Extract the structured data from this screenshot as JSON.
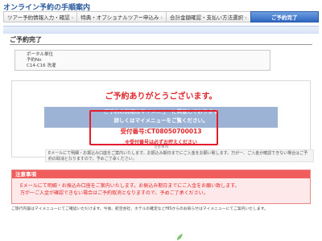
{
  "header": {
    "title": "オンライン予約の手順案内"
  },
  "steps": [
    {
      "label": "ツアー予約情報入力・確認",
      "active": false
    },
    {
      "label": "特典・オプショナルツアー申込み",
      "active": false
    },
    {
      "label": "合計金額確認・支払い方法選択",
      "active": false
    },
    {
      "label": "ご予約完了",
      "active": true
    }
  ],
  "main": {
    "section_title": "ご予約完了",
    "tour_info": [
      "ポータル単位",
      "予約No",
      "C14-C16 洗濯"
    ],
    "thanks_title": "ご予約ありがとうございます。",
    "notice_line1": "ご予約の詳細はマイメニューに掲載しております",
    "notice_line2": "詳しくはマイメニューをご覧ください。",
    "receipt": "受付番号:CT08050700013",
    "receipt_note": "※受付番号は必ずお控えください",
    "small_note": "注意事項",
    "email_note": "Eメールにて明細・お振込み口座をご案内いたします。お振込み期日までにご入金をお願い致します。万が一、ご入金が確認できない場合はご予約の取消となりますので、予めご了承ください。"
  },
  "caution": {
    "title": "注意事項",
    "lines": [
      "Eメールにて明細・お振込み口座をご案内いたします。お振込み期日までにご入金をお願い致します。",
      "万が一ご入金が確認できない場合はご予約取消となりますので、予めご了承ください。"
    ]
  },
  "footer": {
    "text": "ご旅行内容はマイメニューにてご確認いただけます。今後、航空会社、ホテルの確定などHISからのお知らせはマイメニューにてご案内いたします。"
  },
  "colors": {
    "accent_red": "#e0262b",
    "step_active": "#2f66c0",
    "title_blue": "#2a5b9c"
  }
}
